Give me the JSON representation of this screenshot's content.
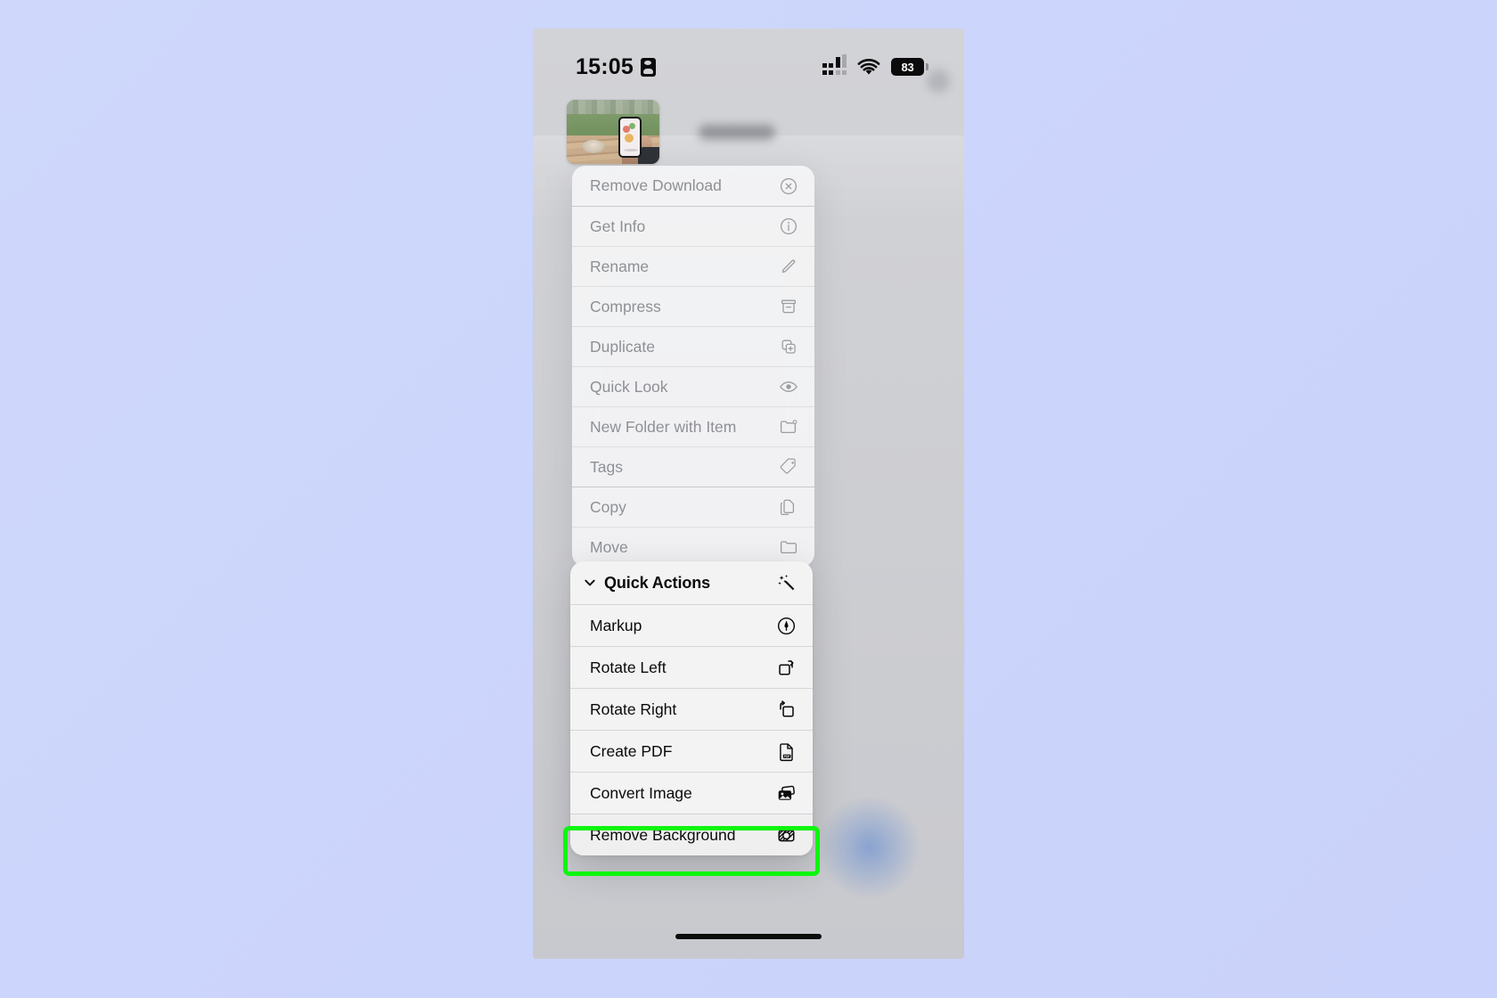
{
  "status_bar": {
    "clock": "15:05",
    "recording_icon": "screen-recording-icon",
    "cellular_icon": "cellular-signal-icon",
    "wifi_icon": "wifi-icon",
    "battery_percent": "83"
  },
  "header": {
    "thumbnail_name": "file-thumbnail",
    "title_redacted": "",
    "accessory_redacted": ""
  },
  "context_menu": {
    "items": [
      {
        "label": "Remove Download",
        "icon": "remove-download-icon",
        "group": 0
      },
      {
        "label": "Get Info",
        "icon": "info-circle-icon",
        "group": 1
      },
      {
        "label": "Rename",
        "icon": "pencil-icon",
        "group": 1
      },
      {
        "label": "Compress",
        "icon": "archivebox-icon",
        "group": 1
      },
      {
        "label": "Duplicate",
        "icon": "duplicate-icon",
        "group": 1
      },
      {
        "label": "Quick Look",
        "icon": "eye-icon",
        "group": 1
      },
      {
        "label": "New Folder with Item",
        "icon": "new-folder-icon",
        "group": 1
      },
      {
        "label": "Tags",
        "icon": "tag-icon",
        "group": 1
      },
      {
        "label": "Copy",
        "icon": "copy-icon",
        "group": 2
      },
      {
        "label": "Move",
        "icon": "folder-icon",
        "group": 2
      }
    ]
  },
  "quick_actions": {
    "title": "Quick Actions",
    "chevron_icon": "chevron-down-icon",
    "header_icon": "magic-wand-sparkles-icon",
    "items": [
      {
        "label": "Markup",
        "icon": "markup-pen-circle-icon",
        "highlighted": false
      },
      {
        "label": "Rotate Left",
        "icon": "rotate-left-icon",
        "highlighted": false
      },
      {
        "label": "Rotate Right",
        "icon": "rotate-right-icon",
        "highlighted": false
      },
      {
        "label": "Create PDF",
        "icon": "create-pdf-icon",
        "highlighted": false
      },
      {
        "label": "Convert Image",
        "icon": "convert-image-icon",
        "highlighted": false
      },
      {
        "label": "Remove Background",
        "icon": "remove-background-icon",
        "highlighted": true
      }
    ]
  },
  "annotation": {
    "highlight_target": "Remove Background",
    "highlight_color": "#0ef50e"
  },
  "colors": {
    "page_background": "#ccd5fb",
    "phone_backdrop": "#cfd0d4",
    "panel_background": "#f3f3f4",
    "menu_text_dim": "#8e9095",
    "panel_text": "#0a0a0b"
  }
}
